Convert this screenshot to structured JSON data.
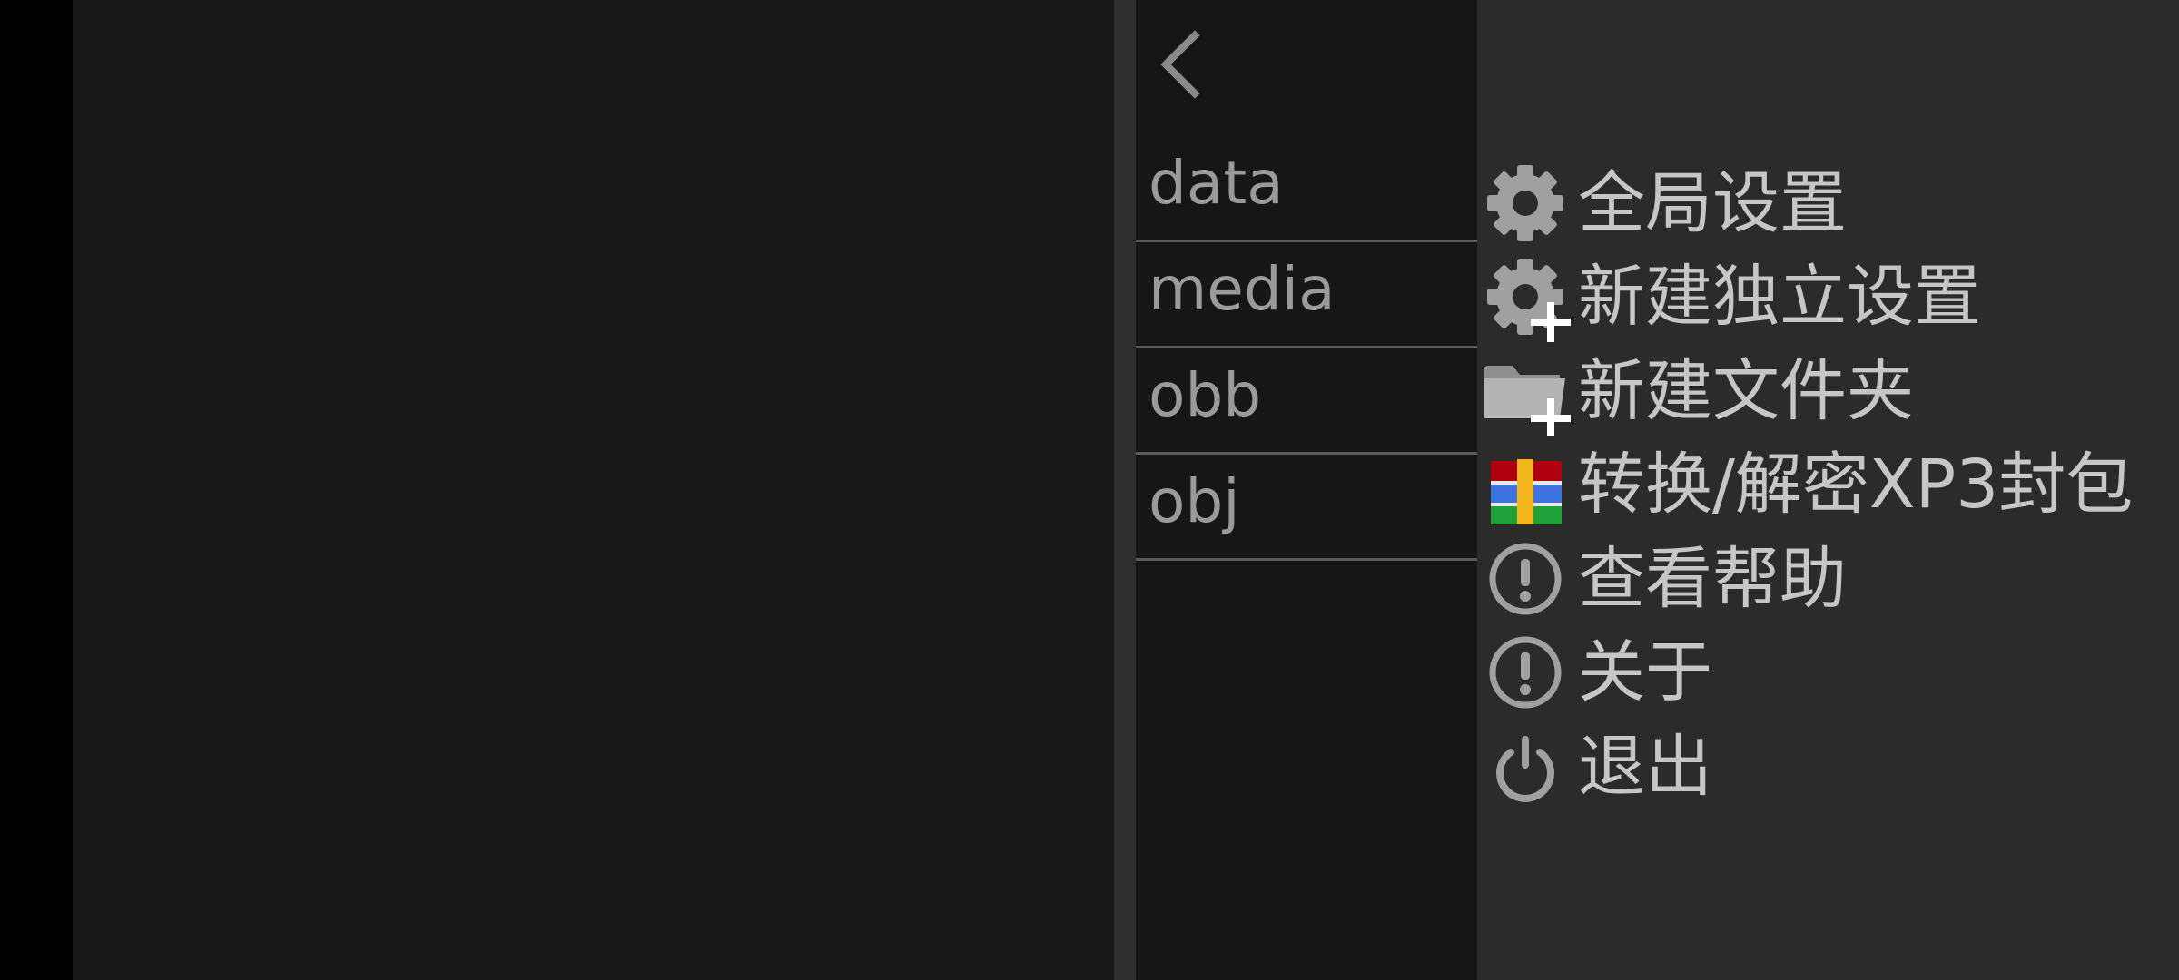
{
  "navigation": {
    "back_icon": "chevron-left-icon"
  },
  "file_list": {
    "items": [
      {
        "name": "data"
      },
      {
        "name": "media"
      },
      {
        "name": "obb"
      },
      {
        "name": "obj"
      }
    ]
  },
  "menu": {
    "items": [
      {
        "label": "全局设置",
        "icon": "gear-icon"
      },
      {
        "label": "新建独立设置",
        "icon": "gear-plus-icon"
      },
      {
        "label": "新建文件夹",
        "icon": "folder-plus-icon"
      },
      {
        "label": "转换/解密XP3封包",
        "icon": "xp3-package-icon"
      },
      {
        "label": "查看帮助",
        "icon": "info-circle-icon"
      },
      {
        "label": "关于",
        "icon": "info-circle-icon"
      },
      {
        "label": "退出",
        "icon": "power-icon"
      }
    ]
  },
  "colors": {
    "main_background": "#181818",
    "file_pane_background": "#161616",
    "menu_background": "#2b2b2b",
    "text_gray": "#9a9a9a",
    "menu_text": "#c6c6c6",
    "icon_gray": "#a0a0a0"
  }
}
